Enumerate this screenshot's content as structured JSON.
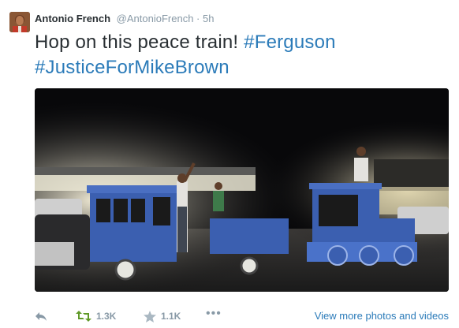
{
  "tweet": {
    "author": {
      "name": "Antonio French",
      "handle": "@AntonioFrench",
      "separator": "·",
      "time": "5h"
    },
    "text": {
      "lead": "Hop on this peace train! ",
      "hashtag1": "#Ferguson",
      "hashtag2": "#JusticeForMikeBrown"
    },
    "media": {
      "alt_icon": "photo-of-kids-on-toy-train-at-night"
    },
    "actions": {
      "reply_icon": "reply-icon",
      "retweet_count": "1.3K",
      "favorite_count": "1.1K",
      "more_label": "•••",
      "view_more": "View more photos and videos"
    },
    "colors": {
      "link": "#2b7bb9",
      "retweet": "#609928",
      "muted": "#8899a6",
      "text": "#292f33"
    }
  }
}
